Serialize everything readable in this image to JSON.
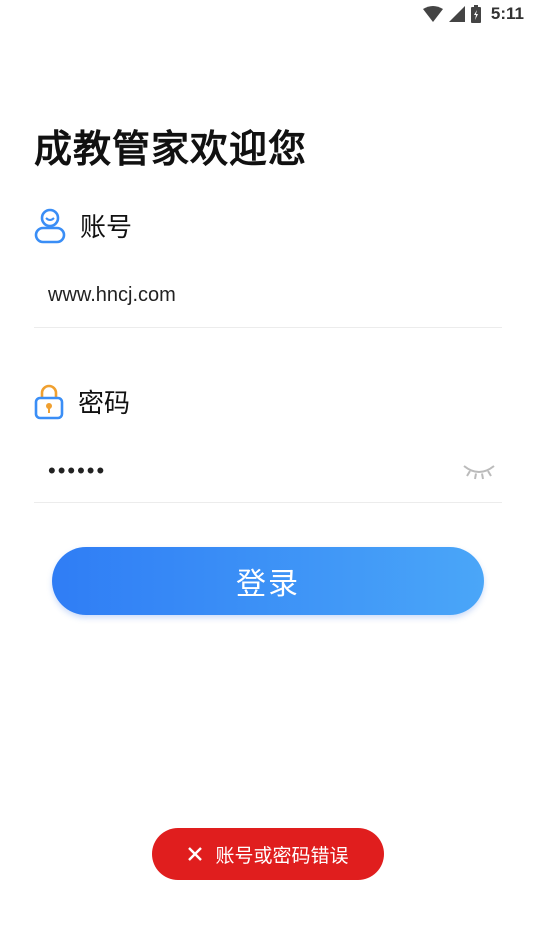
{
  "status_bar": {
    "time": "5:11",
    "icons": [
      "wifi-icon",
      "signal-icon",
      "battery-icon"
    ]
  },
  "login": {
    "title": "成教管家欢迎您",
    "account_label": "账号",
    "account_value": "www.hncj.com",
    "password_label": "密码",
    "password_value": "123456",
    "login_button": "登录"
  },
  "toast": {
    "message": "账号或密码错误",
    "icon": "close-icon"
  },
  "colors": {
    "accent": "#2f7df5",
    "accent_end": "#4aa6f8",
    "error": "#e01e1e",
    "lock_icon": "#f0a030"
  }
}
